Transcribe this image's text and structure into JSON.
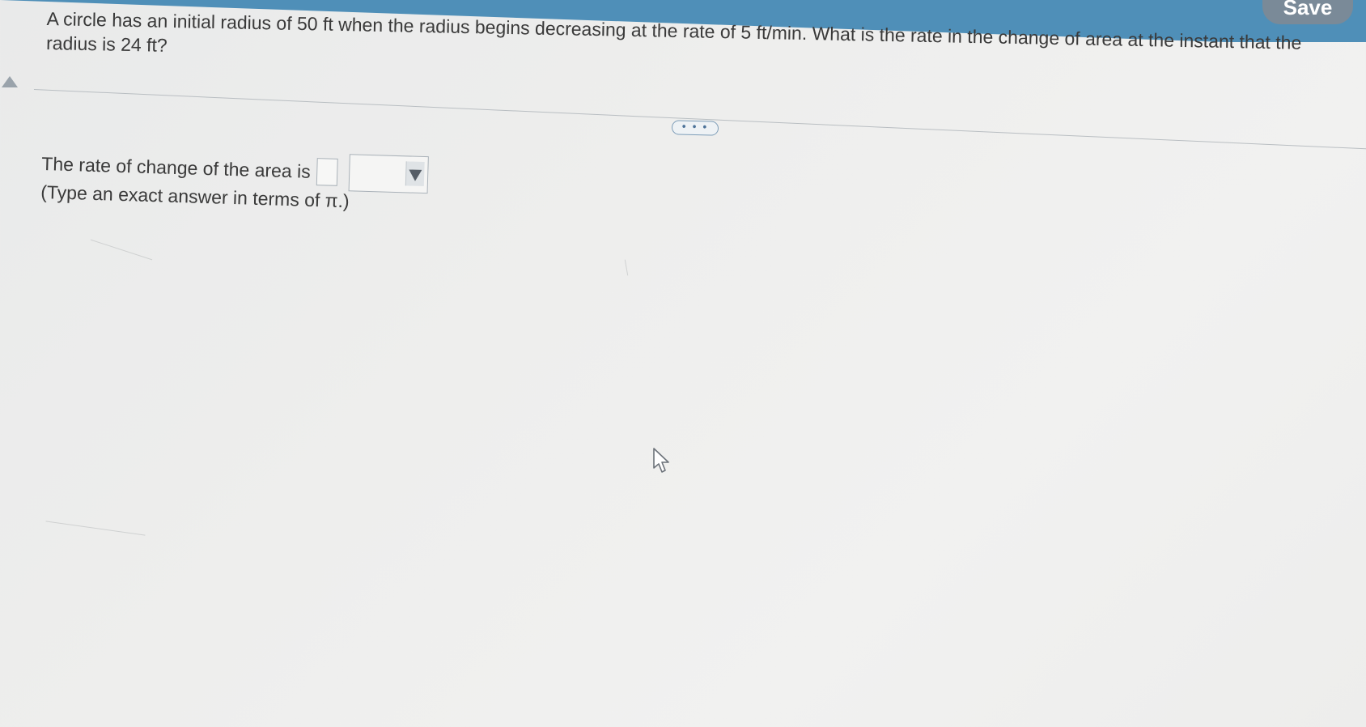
{
  "toolbar": {
    "save_label": "Save"
  },
  "question": {
    "text": "A circle has an initial radius of 50 ft when the radius begins decreasing at the rate of 5 ft/min. What is the rate in the change of area at the instant that the radius is 24 ft?"
  },
  "more_button": {
    "label": "• • •"
  },
  "answer": {
    "prefix": "The rate of change of the area is",
    "value": "",
    "unit_selected": "",
    "hint": "(Type an exact answer in terms of π.)"
  },
  "icons": {
    "scroll": "triangle-up-icon",
    "cursor": "mouse-pointer-icon",
    "dropdown": "triangle-down-icon"
  },
  "colors": {
    "accent_bar": "#4f8fb8",
    "save_button": "#7a8a98",
    "text": "#3a3a3a"
  }
}
